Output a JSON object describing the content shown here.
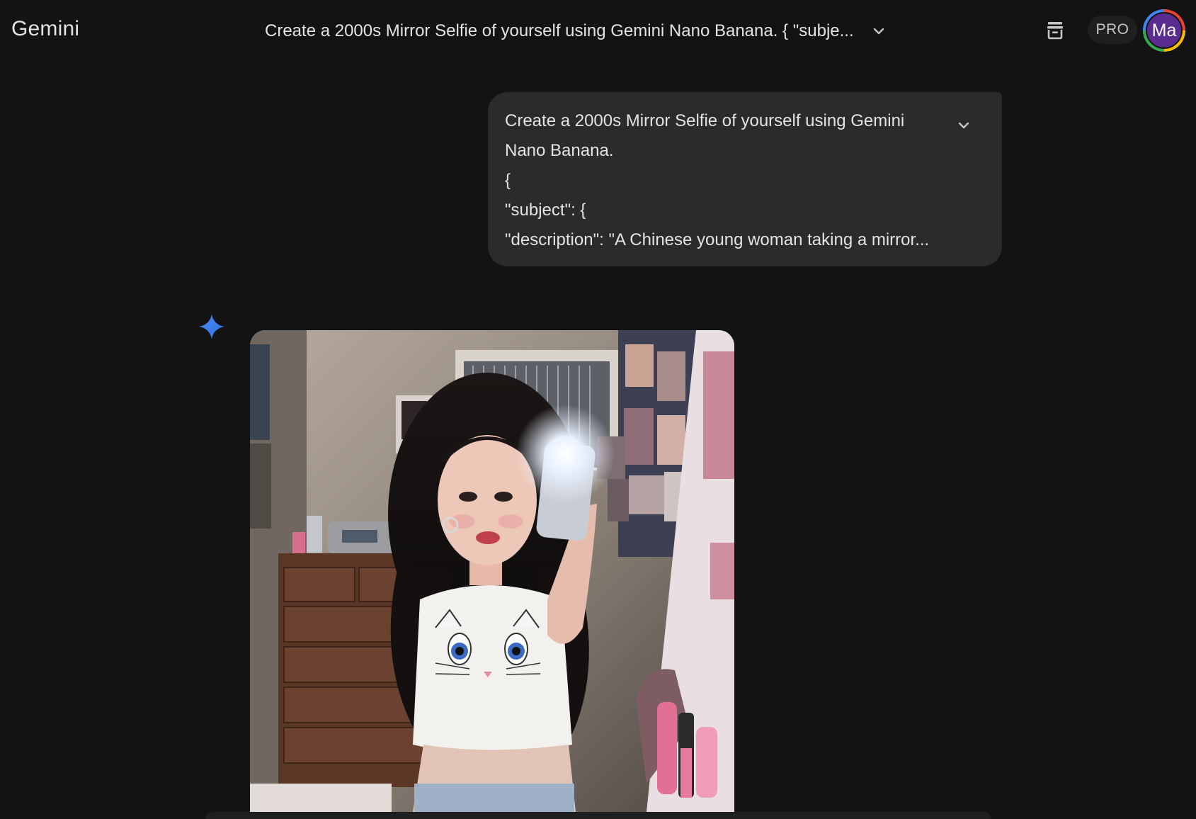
{
  "app": {
    "brand": "Gemini",
    "conversation_title": "Create a 2000s Mirror Selfie of yourself using Gemini Nano Banana. { \"subje...",
    "plan_badge": "PRO",
    "user_initials": "Ma"
  },
  "icons": {
    "title_dropdown": "chevron-down-icon",
    "toolbar": "trash-icon",
    "bubble_expand": "chevron-down-icon",
    "response": "gemini-sparkle-icon"
  },
  "prompt": {
    "lines": [
      "Create a 2000s Mirror Selfie of yourself using Gemini",
      "Nano Banana.",
      "{",
      "\"subject\": {",
      "\"description\": \"A Chinese young woman taking a mirror..."
    ]
  },
  "colors": {
    "background": "#131314",
    "bubble": "#2a2b2d",
    "spark": "#4285f4",
    "avatar": "#5b2c8f"
  }
}
